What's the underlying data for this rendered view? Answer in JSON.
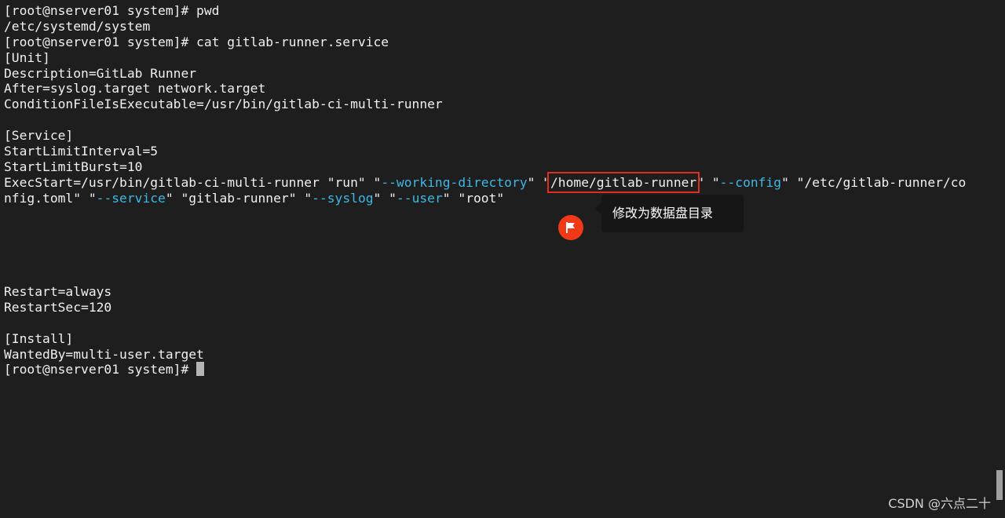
{
  "terminal": {
    "lines": [
      {
        "text": "[root@nserver01 system]# pwd"
      },
      {
        "text": "/etc/systemd/system"
      },
      {
        "text": "[root@nserver01 system]# cat gitlab-runner.service"
      },
      {
        "text": "[Unit]"
      },
      {
        "text": "Description=GitLab Runner"
      },
      {
        "text": "After=syslog.target network.target"
      },
      {
        "text": "ConditionFileIsExecutable=/usr/bin/gitlab-ci-multi-runner"
      },
      {
        "text": ""
      },
      {
        "text": "[Service]"
      },
      {
        "text": "StartLimitInterval=5"
      },
      {
        "text": "StartLimitBurst=10"
      }
    ],
    "exec_line": {
      "p1": "ExecStart=/usr/bin/gitlab-ci-multi-runner \"run\" \"",
      "c1": "--working-directory",
      "p2": "\" \"",
      "highlight": "/home/gitlab-runner",
      "p3": "\" \"",
      "c2": "--config",
      "p4": "\" \"/etc/gitlab-runner/co"
    },
    "exec_line2": {
      "p1": "nfig.toml\" \"",
      "c1": "--service",
      "p2": "\" \"gitlab-runner\" \"",
      "c2": "--syslog",
      "p3": "\" \"",
      "c3": "--user",
      "p4": "\" \"root\""
    },
    "lines_after": [
      {
        "text": ""
      },
      {
        "text": ""
      },
      {
        "text": ""
      },
      {
        "text": ""
      },
      {
        "text": ""
      },
      {
        "text": "Restart=always"
      },
      {
        "text": "RestartSec=120"
      },
      {
        "text": ""
      },
      {
        "text": "[Install]"
      },
      {
        "text": "WantedBy=multi-user.target"
      }
    ],
    "prompt": "[root@nserver01 system]# "
  },
  "annotation": {
    "tooltip_text": "修改为数据盘目录",
    "badge_icon": "flag-icon",
    "badge_color": "#f03a17",
    "highlight_color": "#e02d1d"
  },
  "watermark": {
    "text": "CSDN @六点二十"
  },
  "colors": {
    "background": "#1e1e1e",
    "text": "#f0f0f0",
    "option": "#3db8e6"
  }
}
